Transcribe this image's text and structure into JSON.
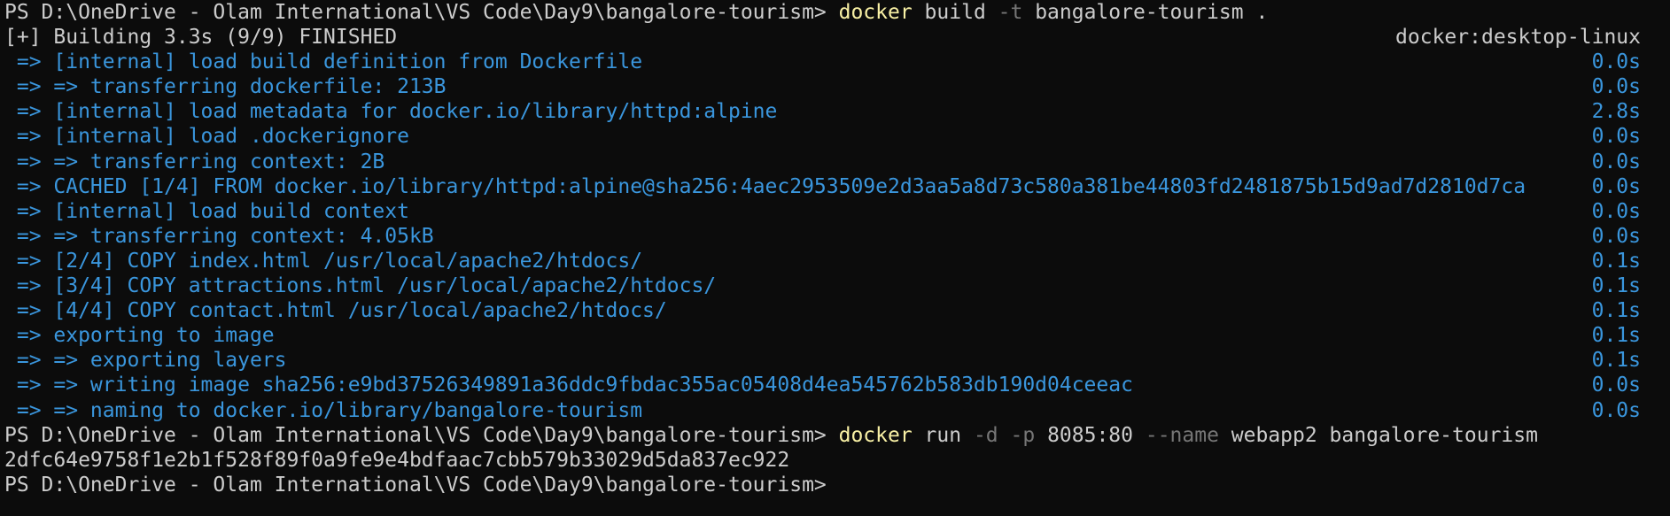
{
  "terminal": {
    "prompt": "PS D:\\OneDrive - Olam International\\VS Code\\Day9\\bangalore-tourism> ",
    "build_command": {
      "cmd": "docker",
      "rest_1": " build ",
      "flag": "-t",
      "rest_2": " bangalore-tourism ."
    },
    "build_status": {
      "text": "[+] Building 3.3s (9/9) FINISHED",
      "context": "docker:desktop-linux"
    },
    "steps": [
      {
        "text": " => [internal] load build definition from Dockerfile",
        "time": "0.0s"
      },
      {
        "text": " => => transferring dockerfile: 213B",
        "time": "0.0s"
      },
      {
        "text": " => [internal] load metadata for docker.io/library/httpd:alpine",
        "time": "2.8s"
      },
      {
        "text": " => [internal] load .dockerignore",
        "time": "0.0s"
      },
      {
        "text": " => => transferring context: 2B",
        "time": "0.0s"
      },
      {
        "text": " => CACHED [1/4] FROM docker.io/library/httpd:alpine@sha256:4aec2953509e2d3aa5a8d73c580a381be44803fd2481875b15d9ad7d2810d7ca",
        "time": "0.0s"
      },
      {
        "text": " => [internal] load build context",
        "time": "0.0s"
      },
      {
        "text": " => => transferring context: 4.05kB",
        "time": "0.0s"
      },
      {
        "text": " => [2/4] COPY index.html /usr/local/apache2/htdocs/",
        "time": "0.1s"
      },
      {
        "text": " => [3/4] COPY attractions.html /usr/local/apache2/htdocs/",
        "time": "0.1s"
      },
      {
        "text": " => [4/4] COPY contact.html /usr/local/apache2/htdocs/",
        "time": "0.1s"
      },
      {
        "text": " => exporting to image",
        "time": "0.1s"
      },
      {
        "text": " => => exporting layers",
        "time": "0.1s"
      },
      {
        "text": " => => writing image sha256:e9bd37526349891a36ddc9fbdac355ac05408d4ea545762b583db190d04ceeac",
        "time": "0.0s"
      },
      {
        "text": " => => naming to docker.io/library/bangalore-tourism",
        "time": "0.0s"
      }
    ],
    "run_command": {
      "cmd": "docker",
      "rest_1": " run ",
      "flag_1": "-d",
      "rest_2": " ",
      "flag_2": "-p",
      "rest_3": " 8085:80 ",
      "flag_3": "--name",
      "rest_4": " webapp2 bangalore-tourism"
    },
    "container_id": "2dfc64e9758f1e2b1f528f89f0a9fe9e4bdfaac7cbb579b33029d5da837ec922",
    "colors": {
      "background": "#0c0c0c",
      "text": "#cccccc",
      "command": "#f9f1a5",
      "flag": "#767676",
      "step": "#3a96dd"
    }
  }
}
